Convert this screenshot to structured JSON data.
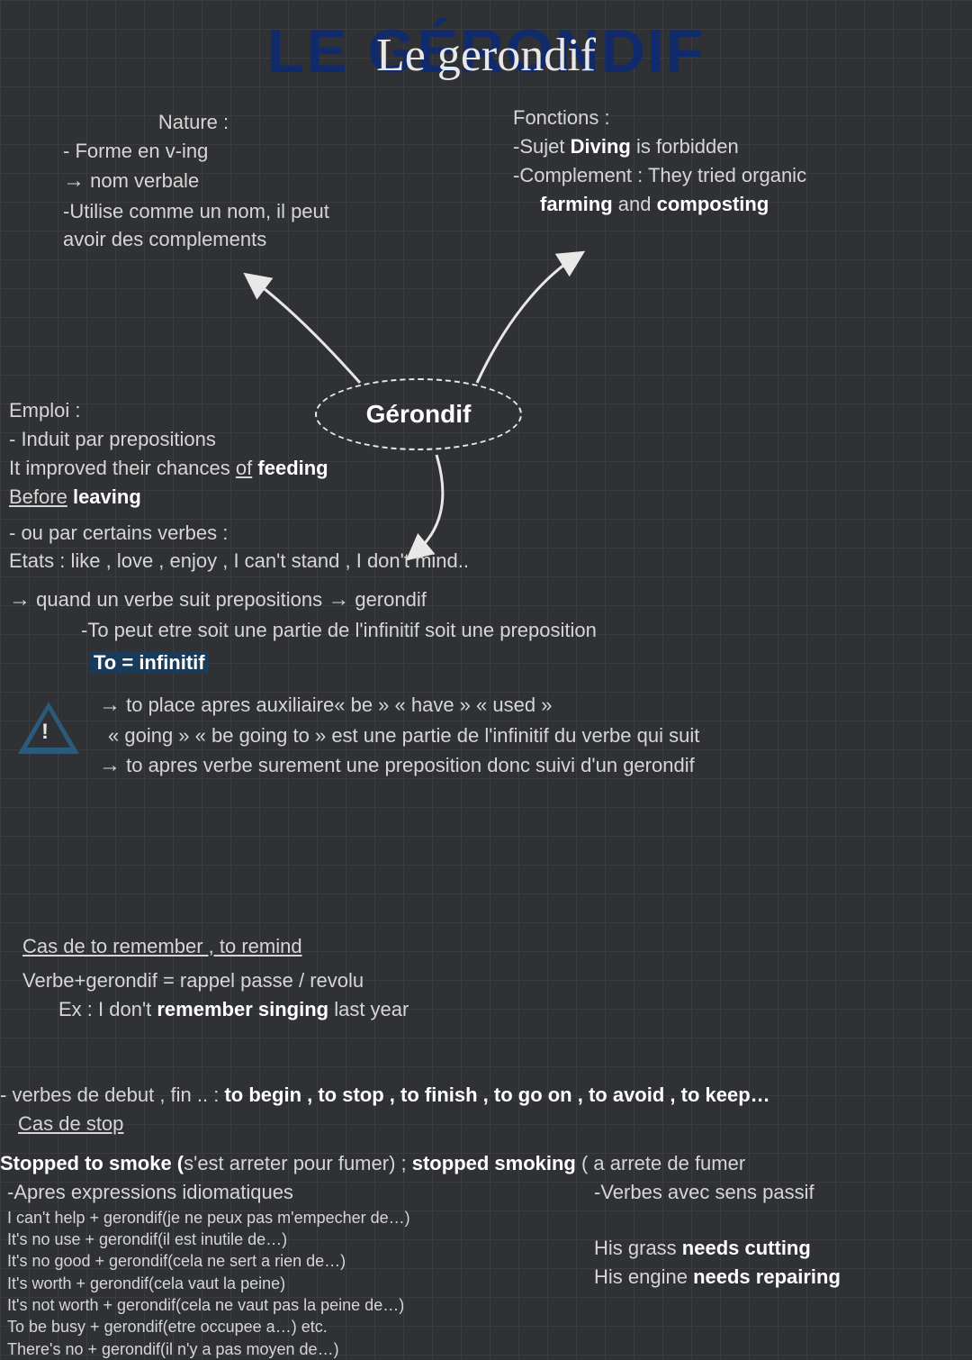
{
  "title_back": "LE GÉRONDIF",
  "title_front": "Le gerondif",
  "bubble": "Gérondif",
  "nature": {
    "heading": "Nature :",
    "l1": "- Forme en v-ing",
    "l2a": "→",
    "l2b": " nom verbale",
    "l3": "-Utilise comme un nom, il peut avoir des complements"
  },
  "fonctions": {
    "heading": "Fonctions :",
    "sujet_a": "-Sujet ",
    "sujet_b": "Diving",
    "sujet_c": " is forbidden",
    "comp_a": "-Complement : They tried organic ",
    "comp_b": "farming",
    "comp_c": " and ",
    "comp_d": "composting"
  },
  "emploi": {
    "heading": "Emploi :",
    "prep": "- Induit par prepositions",
    "ex1a": "It improved their chances ",
    "ex1b": "of",
    "ex1c": " ",
    "ex1d": "feeding",
    "ex2a": "Before",
    "ex2b": " ",
    "ex2c": "leaving",
    "verbs": "- ou par certains verbes :",
    "etats": "Etats : like , love , enjoy , I can't stand , I don't mind..",
    "rule_a": "→",
    "rule_b": " quand un verbe suit prepositions ",
    "rule_c": "→",
    "rule_d": " gerondif",
    "to_note": "-To peut etre soit une partie de l'infinitif soit une preposition",
    "to_inf": "To = infinitif",
    "aux_a": "→",
    "aux_b": " to place apres auxiliaire« be » « have » « used »",
    "going": "« going » « be going to » est une partie de l'infinitif du verbe qui suit",
    "apres_a": "→",
    "apres_b": " to apres verbe surement une preposition donc suivi d'un gerondif"
  },
  "remember": {
    "cas": "Cas de to remember , to remind",
    "rule": "Verbe+gerondif = rappel passe / revolu",
    "ex_a": "Ex : I don't ",
    "ex_b": "remember singing",
    "ex_c": " last year"
  },
  "debut": {
    "line_a": "- verbes de debut , fin .. : ",
    "line_b": "to begin , to stop , to finish , to go on , to avoid , to keep…",
    "cas": "Cas de stop",
    "st1a": "Stopped to smoke (",
    "st1b": "s'est arreter pour fumer) ; ",
    "st1c": "stopped smoking",
    "st1d": "  ( a arrete de fumer"
  },
  "idiom": {
    "heading": "-Apres expressions idiomatiques",
    "l1": "I can't help + gerondif(je ne peux pas m'empecher de…)",
    "l2": "It's no use + gerondif(il est inutile de…)",
    "l3": "It's no good + gerondif(cela ne sert a rien de…)",
    "l4": "It's worth + gerondif(cela vaut la peine)",
    "l5": "It's not worth + gerondif(cela ne vaut pas la peine de…)",
    "l6": "To be busy + gerondif(etre occupee a…) etc.",
    "l7": "There's no + gerondif(il n'y a pas moyen de…)"
  },
  "passif": {
    "heading": "-Verbes avec sens passif",
    "ex1a": "His grass ",
    "ex1b": "needs cutting",
    "ex2a": "His engine ",
    "ex2b": "needs repairing"
  }
}
